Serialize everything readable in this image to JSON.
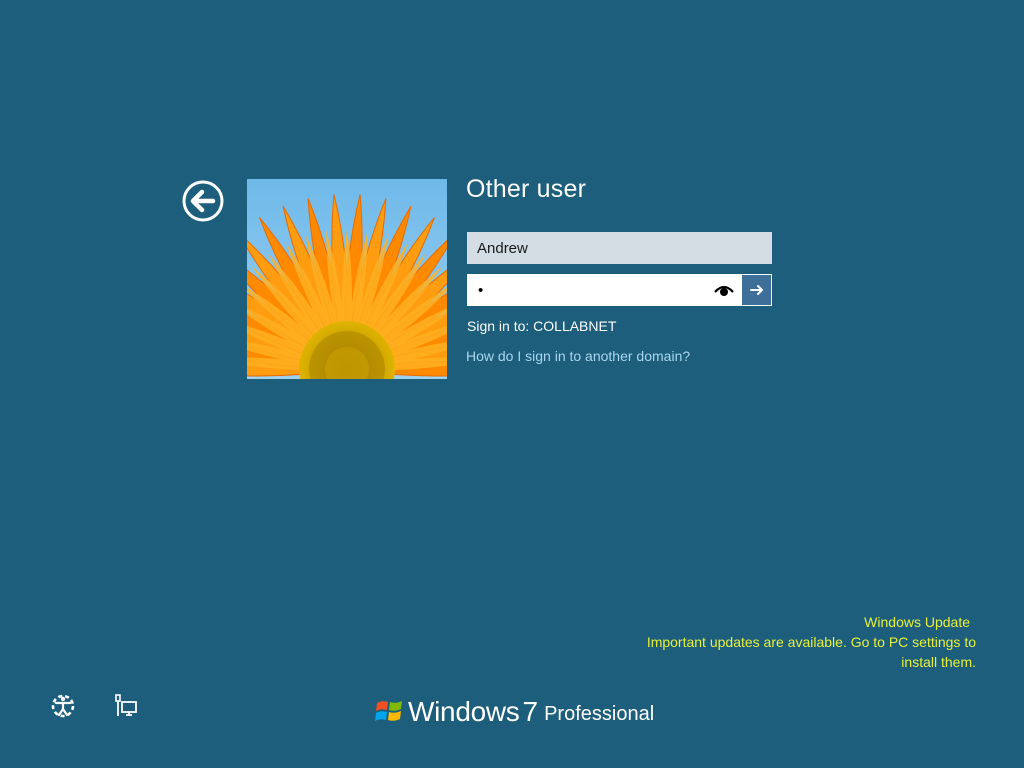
{
  "login": {
    "title": "Other user",
    "username_value": "Andrew",
    "password_value": "•",
    "sign_in_to": "Sign in to: COLLABNET",
    "domain_help_link": "How do I sign in to another domain?"
  },
  "notification": {
    "title": "Windows Update",
    "line1": "Important updates are available. Go to PC settings to",
    "line2": "install them."
  },
  "branding": {
    "windows": "Windows",
    "version": "7",
    "edition": "Professional"
  },
  "icons": {
    "back": "back-arrow-icon",
    "reveal": "eye-icon",
    "submit": "arrow-right-icon",
    "ease": "ease-of-access-icon",
    "network": "network-icon",
    "logo": "windows-flag-logo"
  },
  "colors": {
    "background": "#1c5e7b",
    "notification_text": "#e6f03c",
    "link": "#a9d6ee",
    "submit_button": "#3d6f99",
    "username_field": "#d3dde3"
  }
}
